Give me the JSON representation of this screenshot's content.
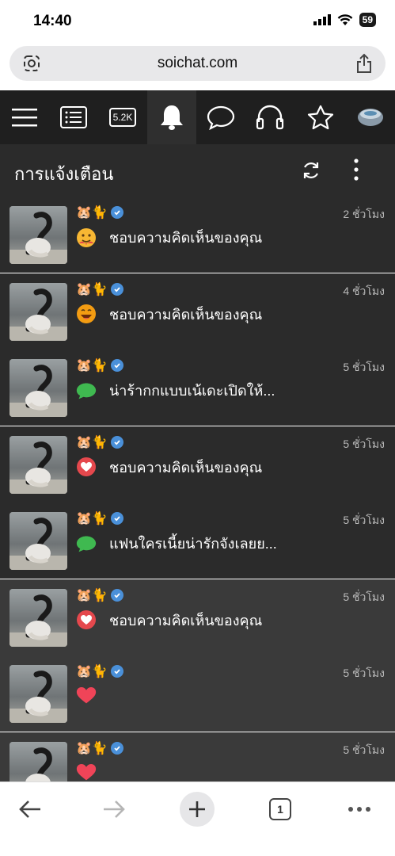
{
  "status_bar": {
    "time": "14:40",
    "battery": "59"
  },
  "browser": {
    "url": "soichat.com",
    "tab_count": "1"
  },
  "nav": {
    "badge": "5.2K"
  },
  "header": {
    "title": "การแจ้งเตือน"
  },
  "notifications": [
    {
      "user": "🐹🐈",
      "reaction": "hug-emoji",
      "text": "ชอบความคิดเห็นของคุณ",
      "time": "2 ชั่วโมง"
    },
    {
      "user": "🐹🐈",
      "reaction": "laugh-emoji",
      "text": "ชอบความคิดเห็นของคุณ",
      "time": "4 ชั่วโมง"
    },
    {
      "user": "🐹🐈",
      "reaction": "comment-bubble",
      "text": "น่าร้ากกแบบเน้เดะเปิดให้...",
      "time": "5 ชั่วโมง"
    },
    {
      "user": "🐹🐈",
      "reaction": "heart-circle",
      "text": "ชอบความคิดเห็นของคุณ",
      "time": "5 ชั่วโมง"
    },
    {
      "user": "🐹🐈",
      "reaction": "comment-bubble",
      "text": "แฟนใครเนี้ยน่ารักจังเลยย...",
      "time": "5 ชั่วโมง"
    },
    {
      "user": "🐹🐈",
      "reaction": "heart-circle",
      "text": "ชอบความคิดเห็นของคุณ",
      "time": "5 ชั่วโมง"
    },
    {
      "user": "🐹🐈",
      "reaction": "heart",
      "text": "",
      "time": "5 ชั่วโมง"
    },
    {
      "user": "🐹🐈",
      "reaction": "heart",
      "text": "",
      "time": "5 ชั่วโมง"
    }
  ],
  "colors": {
    "accent": "#4a90d9",
    "comment": "#3fb950",
    "like": "#e5484d"
  }
}
